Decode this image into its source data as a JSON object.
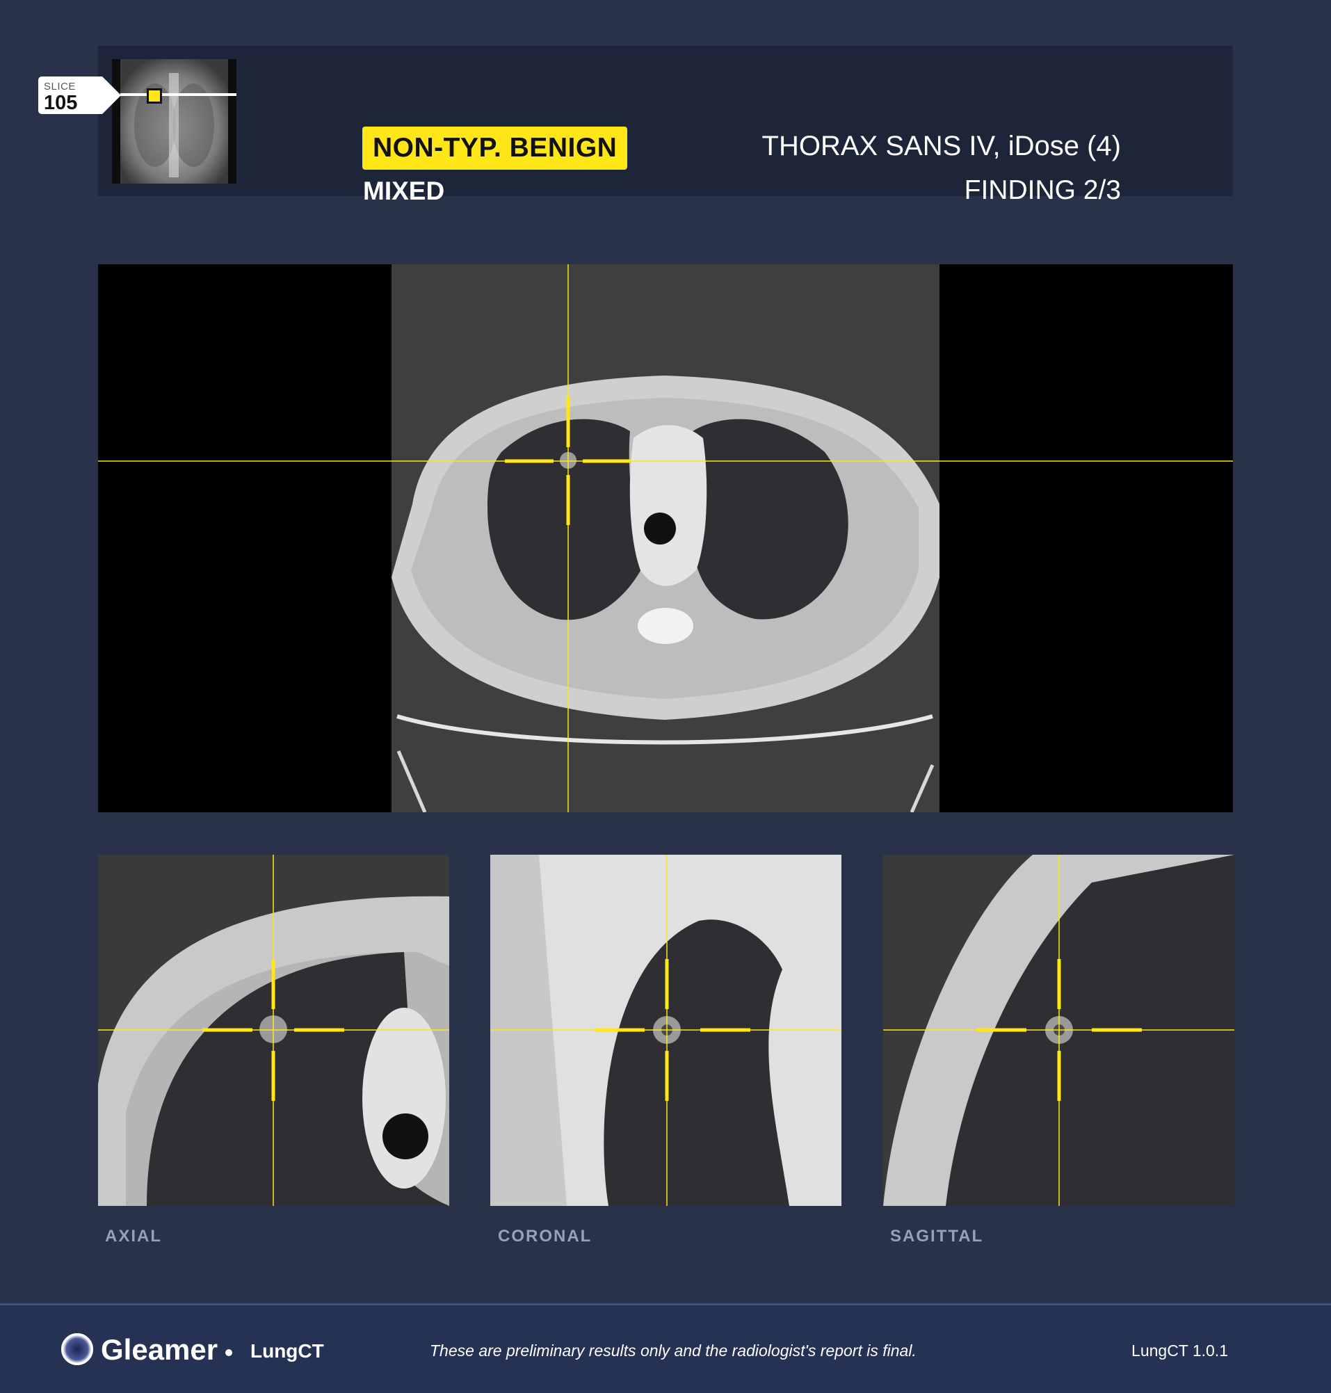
{
  "header": {
    "slice_label": "SLICE",
    "slice_number": "105",
    "classification": "NON-TYP. BENIGN",
    "subtype": "MIXED",
    "exam_description": "THORAX  SANS IV, iDose (4)",
    "finding": "FINDING 2/3"
  },
  "views": {
    "axial": "AXIAL",
    "coronal": "CORONAL",
    "sagittal": "SAGITTAL"
  },
  "footer": {
    "brand": "Gleamer",
    "product": "LungCT",
    "disclaimer": "These are preliminary results only and the radiologist's report is final.",
    "version": "LungCT 1.0.1"
  },
  "colors": {
    "background": "#283248",
    "header_panel": "#1d2638",
    "accent_yellow": "#ffe617",
    "footer": "#263253"
  },
  "icons": [
    "logo-icon",
    "crosshair-icon",
    "slice-marker-icon"
  ]
}
